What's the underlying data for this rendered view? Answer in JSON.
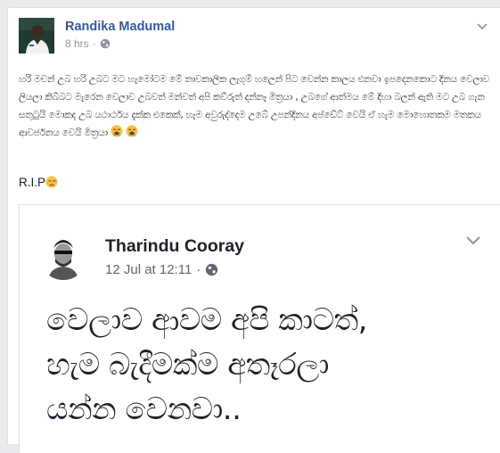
{
  "post": {
    "author": "Randika Madumal",
    "time": "8 hrs",
    "meta_separator": "·",
    "text": "හරි මචන් උබ හරි උබට මට හැමෝටම මේ තාවකාලික ලැගුම් හලෙන් පිට වෙන්න කාලය එනවා ඉපදෙනකොට දිනය වෙලාව ලියලා කිබ්බට මැරෙන වෙලාව උබවත් මන්වත් අපි කව්රුත් දන්නෑ මිත්‍රයා , උබගේ ආත්මය මේ දිහා බලන් ඇති මට උබ ගැන සතුටුයි මොකද උබ යථාර්ථය දැක්ක එකෙක්, හැම අවුරුද්දෙම උබේ උපන්දිනය අප්ඩේට් වෙයි ඒ හැම මොහොතකම මතකය ආවර්ජනය වෙයි මිත්‍රයා",
    "text_emoji": "loudly-crying-face",
    "rip": "R.I.P",
    "rip_emoji": "disappointed-face"
  },
  "shared_post": {
    "author": "Tharindu Cooray",
    "date": "12 Jul at 12:11",
    "meta_separator": "·",
    "lines": [
      "වෙලාව ආවම අපි කාටත්,",
      "හැම බැදීමක්ම අතෑරලා",
      "යන්න වෙනවා.."
    ]
  },
  "icons": {
    "globe": "globe-icon",
    "chevron": "chevron-down-icon"
  },
  "colors": {
    "author_link": "#365899",
    "meta_text": "#90949c",
    "body_text": "#1d2129",
    "page_bg": "#e9ebee"
  }
}
